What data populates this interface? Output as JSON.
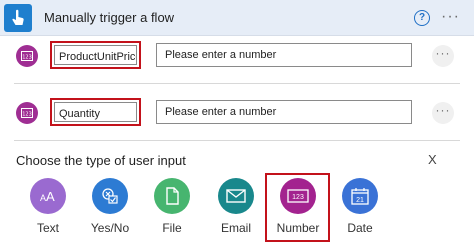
{
  "header": {
    "title": "Manually trigger a flow",
    "help_glyph": "?",
    "more_glyph": "···",
    "icon": "touch-hand-icon",
    "color": "#1f7fce"
  },
  "inputs": [
    {
      "name": "ProductUnitPrice",
      "placeholder": "Please enter a number",
      "icon": "number-type-icon",
      "more_glyph": "···"
    },
    {
      "name": "Quantity",
      "placeholder": "Please enter a number",
      "icon": "number-type-icon",
      "more_glyph": "···"
    }
  ],
  "chooser": {
    "title": "Choose the type of user input",
    "close_label": "X",
    "types": [
      {
        "label": "Text",
        "icon": "text-aa-icon",
        "color": "#9a6ad0",
        "glyph": "AA"
      },
      {
        "label": "Yes/No",
        "icon": "yes-no-icon",
        "color": "#2d7bd3",
        "glyph": ""
      },
      {
        "label": "File",
        "icon": "file-icon",
        "color": "#47b56f",
        "glyph": ""
      },
      {
        "label": "Email",
        "icon": "email-icon",
        "color": "#19888c",
        "glyph": ""
      },
      {
        "label": "Number",
        "icon": "number-icon",
        "color": "#a3238f",
        "glyph": "123",
        "highlighted": true
      },
      {
        "label": "Date",
        "icon": "calendar-icon",
        "color": "#3a72d6",
        "glyph": "21"
      }
    ]
  },
  "colors": {
    "highlight": "#c3121b",
    "param_icon": "#9f2e93",
    "header_bg": "#e6edf7"
  }
}
